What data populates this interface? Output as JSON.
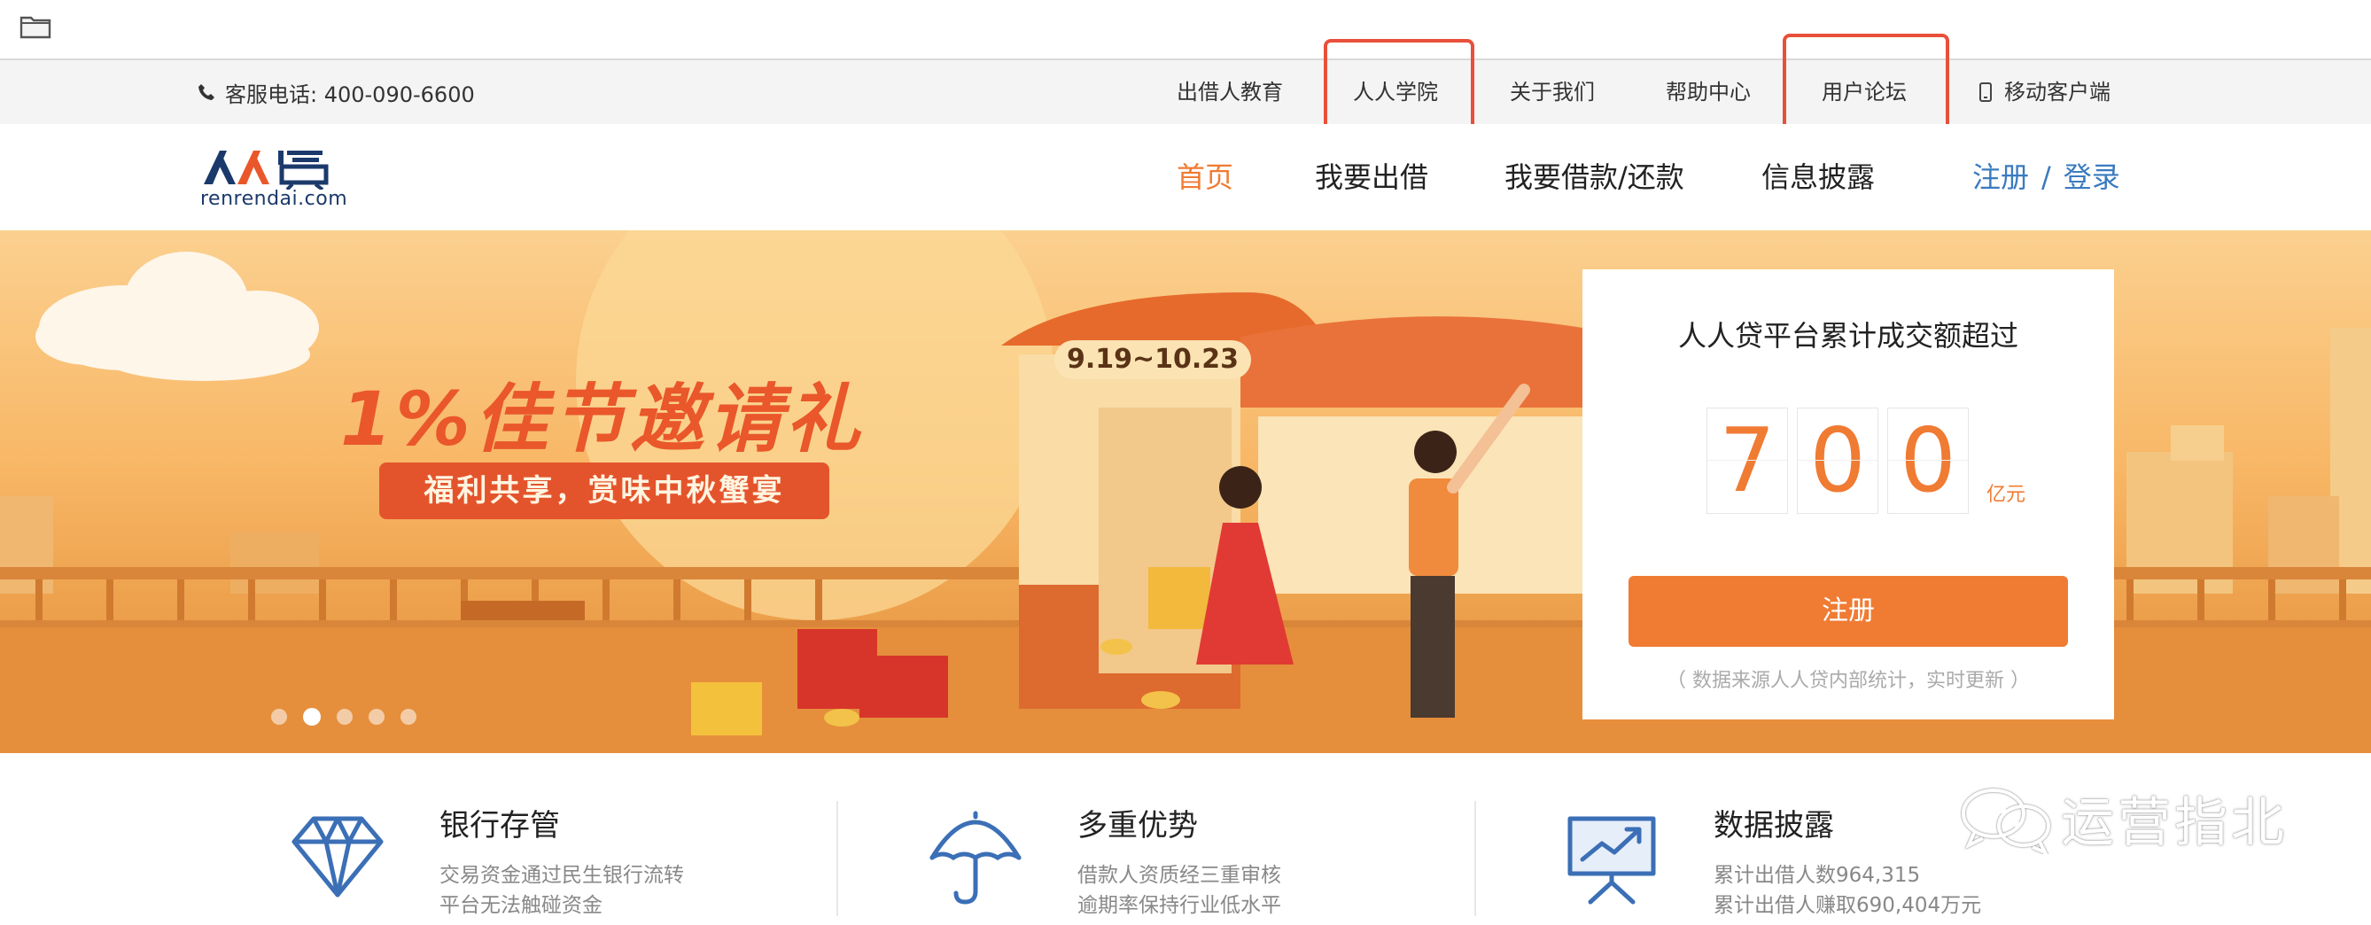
{
  "topbar": {
    "hotline": "客服电话: 400-090-6600",
    "links": [
      "出借人教育",
      "人人学院",
      "关于我们",
      "帮助中心",
      "用户论坛",
      "移动客户端"
    ]
  },
  "header": {
    "logo_text": "人人贷",
    "logo_domain": "renrendai.com",
    "nav": [
      "首页",
      "我要出借",
      "我要借款/还款",
      "信息披露"
    ],
    "register": "注册",
    "auth_sep": "/",
    "login": "登录"
  },
  "banner": {
    "title": "1%佳节邀请礼",
    "subtitle": "福利共享，赏味中秋蟹宴",
    "date": "9.19~10.23",
    "slides": 5,
    "active_slide": 2
  },
  "stats": {
    "title": "人人贷平台累计成交额超过",
    "digits": [
      "7",
      "0",
      "0"
    ],
    "unit": "亿元",
    "register_button": "注册",
    "note": "（ 数据来源人人贷内部统计，实时更新 ）"
  },
  "features": [
    {
      "title": "银行存管",
      "line1": "交易资金通过民生银行流转",
      "line2": "平台无法触碰资金",
      "icon": "diamond-icon"
    },
    {
      "title": "多重优势",
      "line1": "借款人资质经三重审核",
      "line2": "逾期率保持行业低水平",
      "icon": "umbrella-icon"
    },
    {
      "title": "数据披露",
      "line1": "累计出借人数964,315",
      "line2": "累计出借人赚取690,404万元",
      "icon": "chart-board-icon"
    }
  ],
  "watermark": "运营指北",
  "colors": {
    "accent": "#f07b33",
    "link_blue": "#3b7bbf",
    "annotation": "#e8503a",
    "logo_navy": "#1b3a6b"
  }
}
